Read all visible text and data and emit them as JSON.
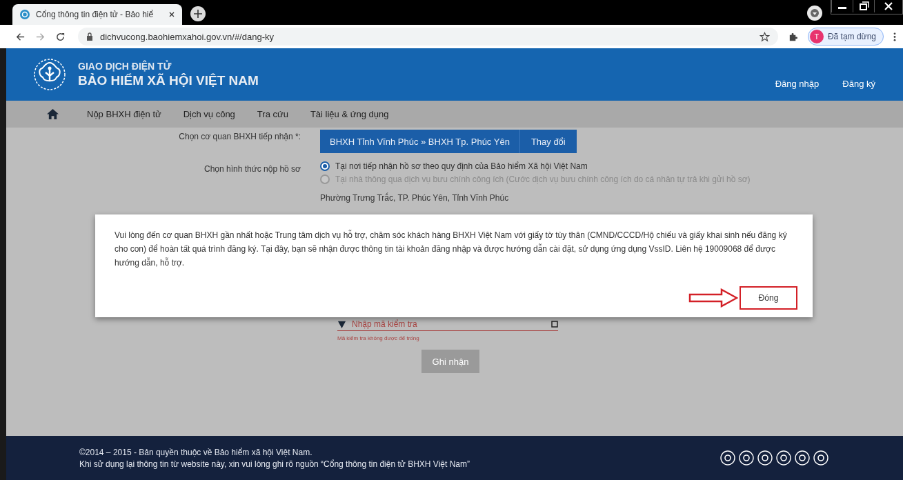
{
  "browser": {
    "tab_title": "Cổng thông tin điện tử - Bảo hiể",
    "url": "dichvucong.baohiemxahoi.gov.vn/#/dang-ky",
    "profile_initial": "T",
    "profile_status": "Đã tạm dừng"
  },
  "header": {
    "line1": "GIAO DỊCH ĐIỆN TỬ",
    "line2": "BẢO HIỂM XÃ HỘI VIỆT NAM",
    "links": [
      "Đăng nhập",
      "Đăng ký"
    ]
  },
  "nav": [
    "Nộp BHXH điện tử",
    "Dịch vụ công",
    "Tra cứu",
    "Tài liệu & ứng dụng"
  ],
  "form": {
    "agency_label": "Chọn cơ quan BHXH tiếp nhận *:",
    "agency_value": "BHXH Tỉnh Vĩnh Phúc » BHXH Tp. Phúc Yên",
    "change_button": "Thay đổi",
    "method_label": "Chọn hình thức nộp hồ sơ",
    "options": [
      {
        "label": "Tại nơi tiếp nhận hồ sơ theo quy định của Bảo hiểm Xã hội Việt Nam",
        "selected": true,
        "disabled": false
      },
      {
        "label": "Tại nhà thông qua dịch vụ bưu chính công ích (Cước dịch vụ bưu chính công ích do cá nhân tự trả khi gửi hồ sơ)",
        "selected": false,
        "disabled": true
      }
    ],
    "address_value": "Phường Trưng Trắc, TP. Phúc Yên, Tỉnh Vĩnh Phúc"
  },
  "captcha": {
    "placeholder": "Nhập mã kiểm tra",
    "error": "Mã kiểm tra không được để trống",
    "submit": "Ghi nhận"
  },
  "modal": {
    "message": "Vui lòng đến cơ quan BHXH gần nhất hoặc Trung tâm dịch vụ hỗ trợ, chăm sóc khách hàng BHXH Việt Nam với giấy tờ tùy thân (CMND/CCCD/Hộ chiếu và giấy khai sinh nếu đăng ký cho con) để hoàn tất quá trình đăng ký. Tại đây, bạn sẽ nhận được thông tin tài khoản đăng nhập và được hướng dẫn cài đặt, sử dụng ứng dụng VssID. Liên hệ 19009068 để được hướng dẫn, hỗ trợ.",
    "close_button": "Đóng"
  },
  "footer": {
    "lines": [
      "©2014 – 2015 - Bản quyền thuộc về Bảo hiểm xã hội Việt Nam.",
      "Khi sử dụng lại thông tin từ website này, xin vui lòng ghi rõ nguồn “Cổng thông tin điện tử BHXH Việt Nam”"
    ]
  }
}
